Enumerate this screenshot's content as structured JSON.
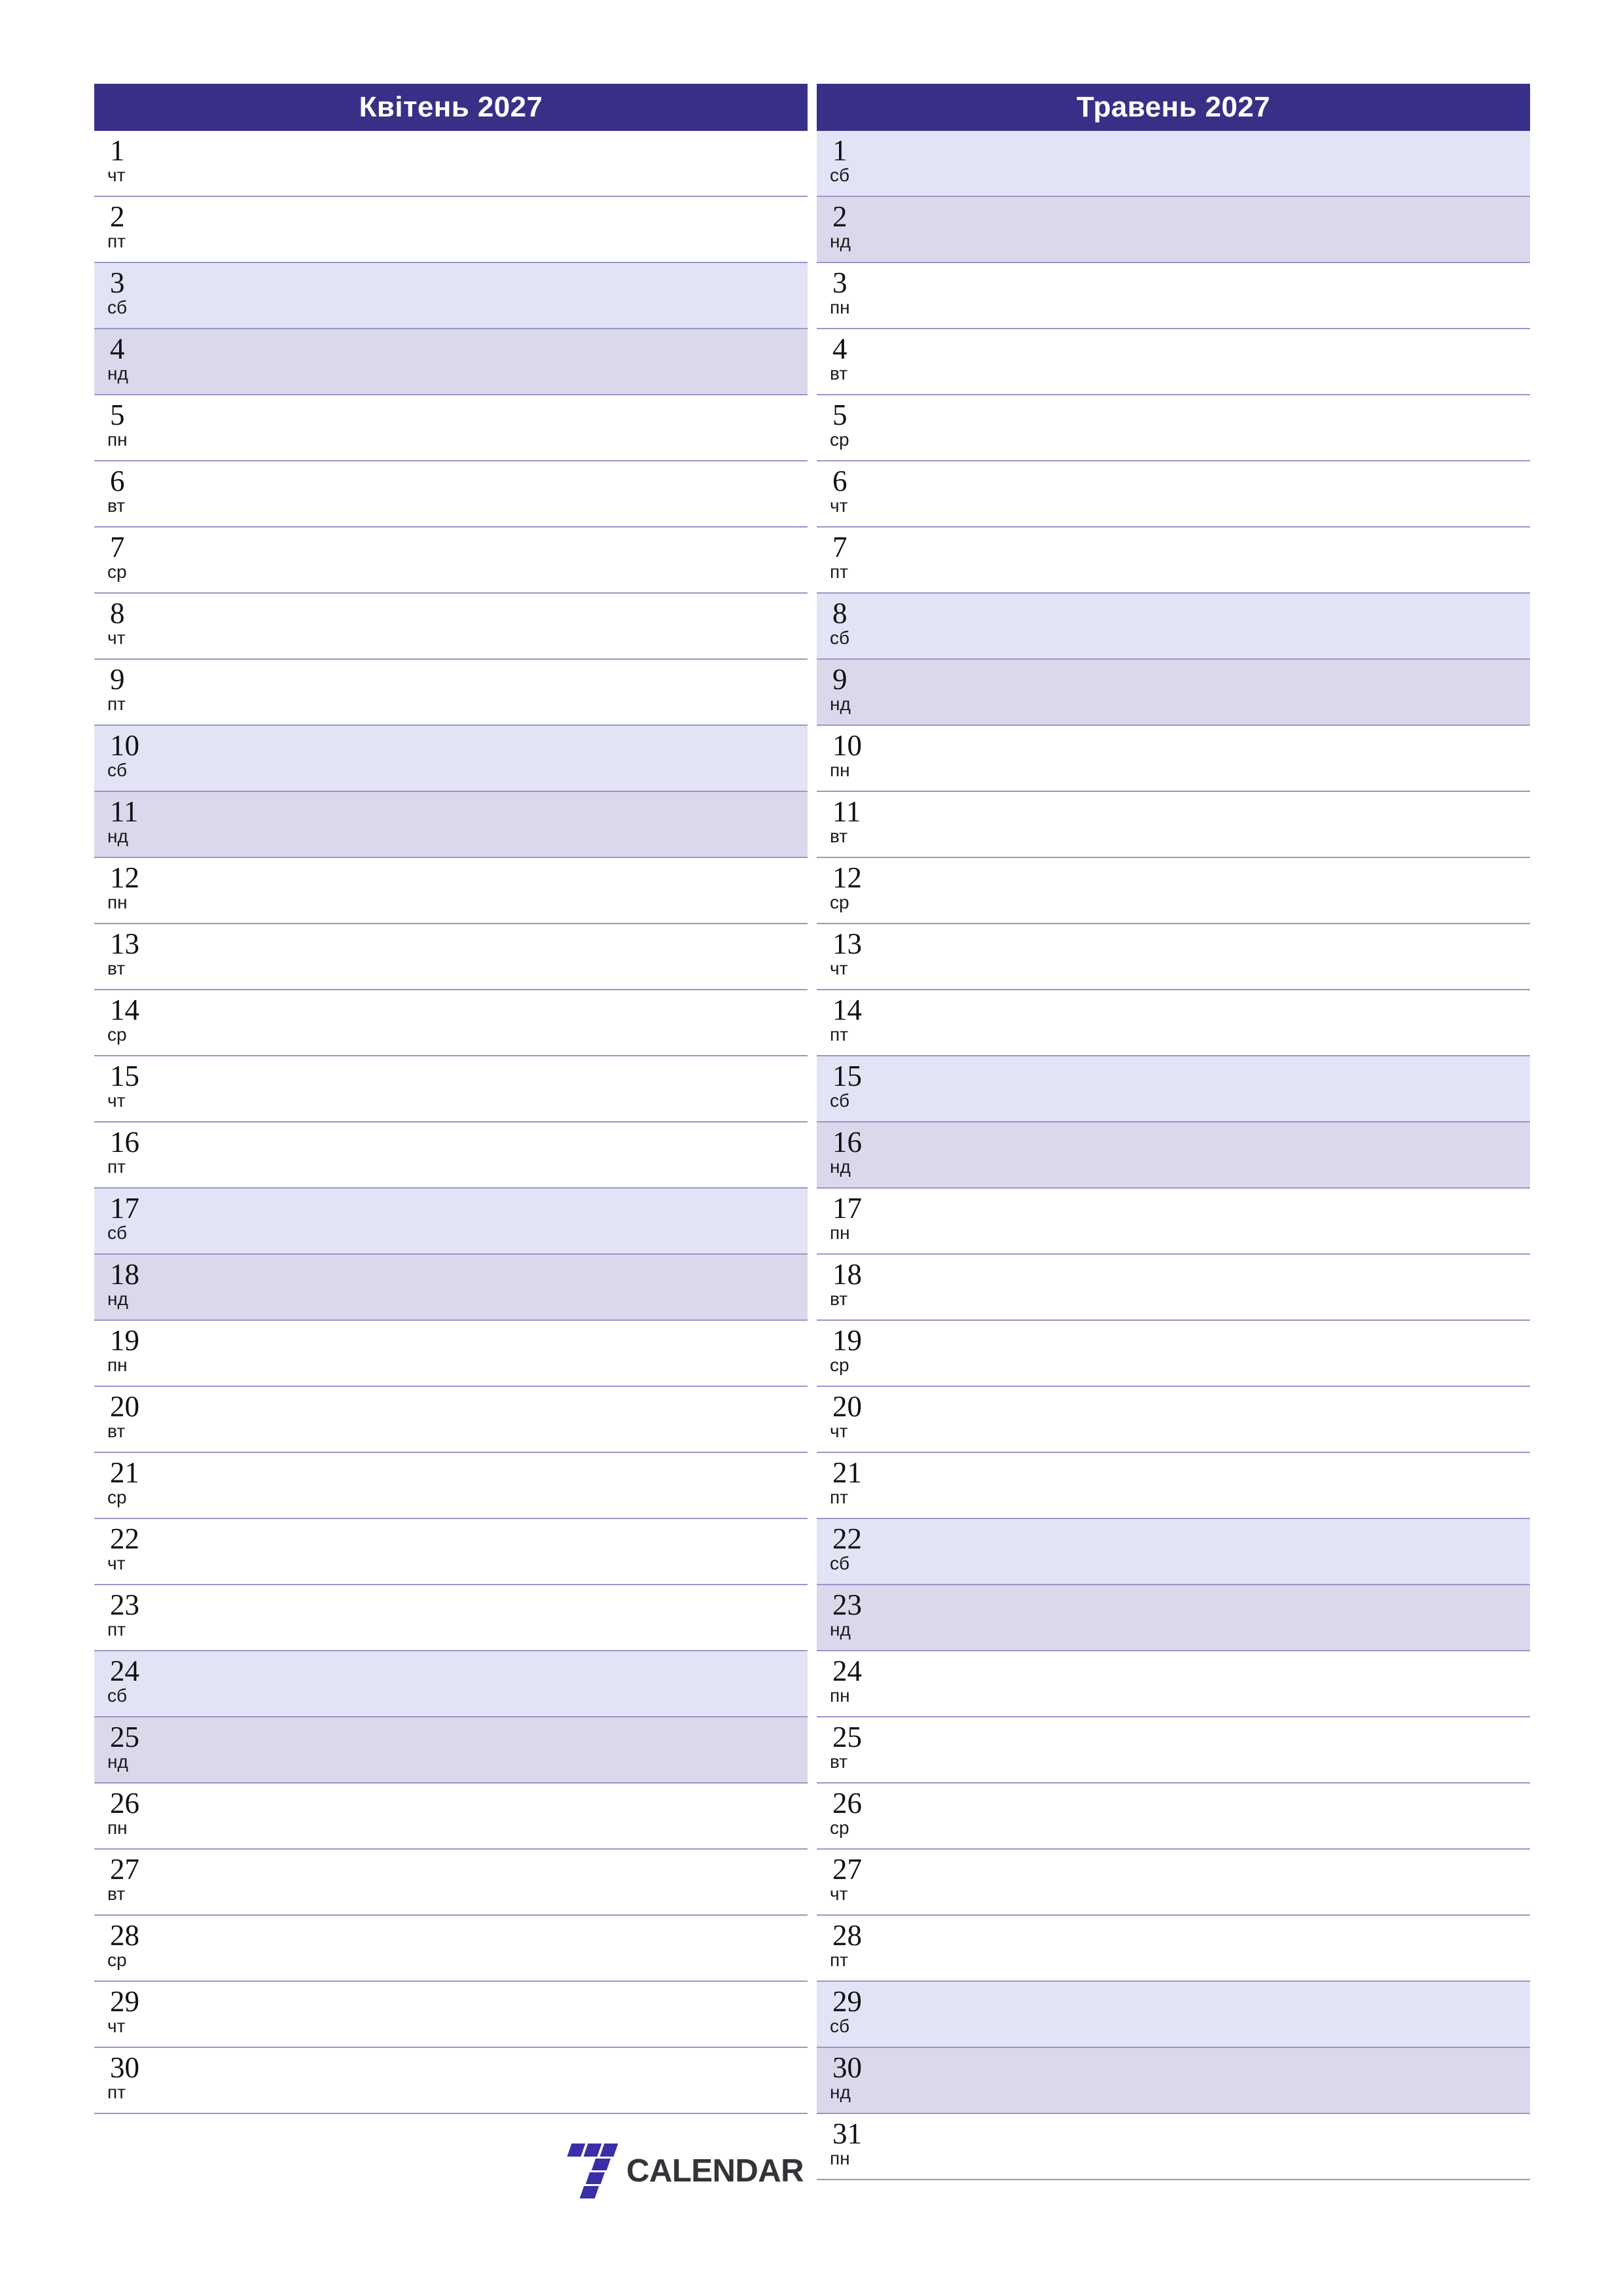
{
  "logo": {
    "mark_name": "seven-logo-mark",
    "text": "CALENDAR",
    "accent_red": "#ee1144",
    "accent_purple": "#3b2fa8",
    "text_color": "#333338"
  },
  "theme": {
    "header_bg": "#383087",
    "header_text": "#ffffff",
    "saturday_bg": "#e3e3f6",
    "sunday_bg": "#dcd8ec",
    "row_border": "#9b95c8",
    "weekday_bg": "#ffffff"
  },
  "months": [
    {
      "title": "Квітень 2027",
      "days": [
        {
          "num": "1",
          "wd": "чт",
          "type": "weekday"
        },
        {
          "num": "2",
          "wd": "пт",
          "type": "weekday"
        },
        {
          "num": "3",
          "wd": "сб",
          "type": "sat"
        },
        {
          "num": "4",
          "wd": "нд",
          "type": "sun"
        },
        {
          "num": "5",
          "wd": "пн",
          "type": "weekday"
        },
        {
          "num": "6",
          "wd": "вт",
          "type": "weekday"
        },
        {
          "num": "7",
          "wd": "ср",
          "type": "weekday"
        },
        {
          "num": "8",
          "wd": "чт",
          "type": "weekday"
        },
        {
          "num": "9",
          "wd": "пт",
          "type": "weekday"
        },
        {
          "num": "10",
          "wd": "сб",
          "type": "sat"
        },
        {
          "num": "11",
          "wd": "нд",
          "type": "sun"
        },
        {
          "num": "12",
          "wd": "пн",
          "type": "weekday"
        },
        {
          "num": "13",
          "wd": "вт",
          "type": "weekday"
        },
        {
          "num": "14",
          "wd": "ср",
          "type": "weekday"
        },
        {
          "num": "15",
          "wd": "чт",
          "type": "weekday"
        },
        {
          "num": "16",
          "wd": "пт",
          "type": "weekday"
        },
        {
          "num": "17",
          "wd": "сб",
          "type": "sat"
        },
        {
          "num": "18",
          "wd": "нд",
          "type": "sun"
        },
        {
          "num": "19",
          "wd": "пн",
          "type": "weekday"
        },
        {
          "num": "20",
          "wd": "вт",
          "type": "weekday"
        },
        {
          "num": "21",
          "wd": "ср",
          "type": "weekday"
        },
        {
          "num": "22",
          "wd": "чт",
          "type": "weekday"
        },
        {
          "num": "23",
          "wd": "пт",
          "type": "weekday"
        },
        {
          "num": "24",
          "wd": "сб",
          "type": "sat"
        },
        {
          "num": "25",
          "wd": "нд",
          "type": "sun"
        },
        {
          "num": "26",
          "wd": "пн",
          "type": "weekday"
        },
        {
          "num": "27",
          "wd": "вт",
          "type": "weekday"
        },
        {
          "num": "28",
          "wd": "ср",
          "type": "weekday"
        },
        {
          "num": "29",
          "wd": "чт",
          "type": "weekday"
        },
        {
          "num": "30",
          "wd": "пт",
          "type": "weekday"
        }
      ]
    },
    {
      "title": "Травень 2027",
      "days": [
        {
          "num": "1",
          "wd": "сб",
          "type": "sat"
        },
        {
          "num": "2",
          "wd": "нд",
          "type": "sun"
        },
        {
          "num": "3",
          "wd": "пн",
          "type": "weekday"
        },
        {
          "num": "4",
          "wd": "вт",
          "type": "weekday"
        },
        {
          "num": "5",
          "wd": "ср",
          "type": "weekday"
        },
        {
          "num": "6",
          "wd": "чт",
          "type": "weekday"
        },
        {
          "num": "7",
          "wd": "пт",
          "type": "weekday"
        },
        {
          "num": "8",
          "wd": "сб",
          "type": "sat"
        },
        {
          "num": "9",
          "wd": "нд",
          "type": "sun"
        },
        {
          "num": "10",
          "wd": "пн",
          "type": "weekday"
        },
        {
          "num": "11",
          "wd": "вт",
          "type": "weekday"
        },
        {
          "num": "12",
          "wd": "ср",
          "type": "weekday"
        },
        {
          "num": "13",
          "wd": "чт",
          "type": "weekday"
        },
        {
          "num": "14",
          "wd": "пт",
          "type": "weekday"
        },
        {
          "num": "15",
          "wd": "сб",
          "type": "sat"
        },
        {
          "num": "16",
          "wd": "нд",
          "type": "sun"
        },
        {
          "num": "17",
          "wd": "пн",
          "type": "weekday"
        },
        {
          "num": "18",
          "wd": "вт",
          "type": "weekday"
        },
        {
          "num": "19",
          "wd": "ср",
          "type": "weekday"
        },
        {
          "num": "20",
          "wd": "чт",
          "type": "weekday"
        },
        {
          "num": "21",
          "wd": "пт",
          "type": "weekday"
        },
        {
          "num": "22",
          "wd": "сб",
          "type": "sat"
        },
        {
          "num": "23",
          "wd": "нд",
          "type": "sun"
        },
        {
          "num": "24",
          "wd": "пн",
          "type": "weekday"
        },
        {
          "num": "25",
          "wd": "вт",
          "type": "weekday"
        },
        {
          "num": "26",
          "wd": "ср",
          "type": "weekday"
        },
        {
          "num": "27",
          "wd": "чт",
          "type": "weekday"
        },
        {
          "num": "28",
          "wd": "пт",
          "type": "weekday"
        },
        {
          "num": "29",
          "wd": "сб",
          "type": "sat"
        },
        {
          "num": "30",
          "wd": "нд",
          "type": "sun"
        },
        {
          "num": "31",
          "wd": "пн",
          "type": "weekday"
        }
      ]
    }
  ]
}
